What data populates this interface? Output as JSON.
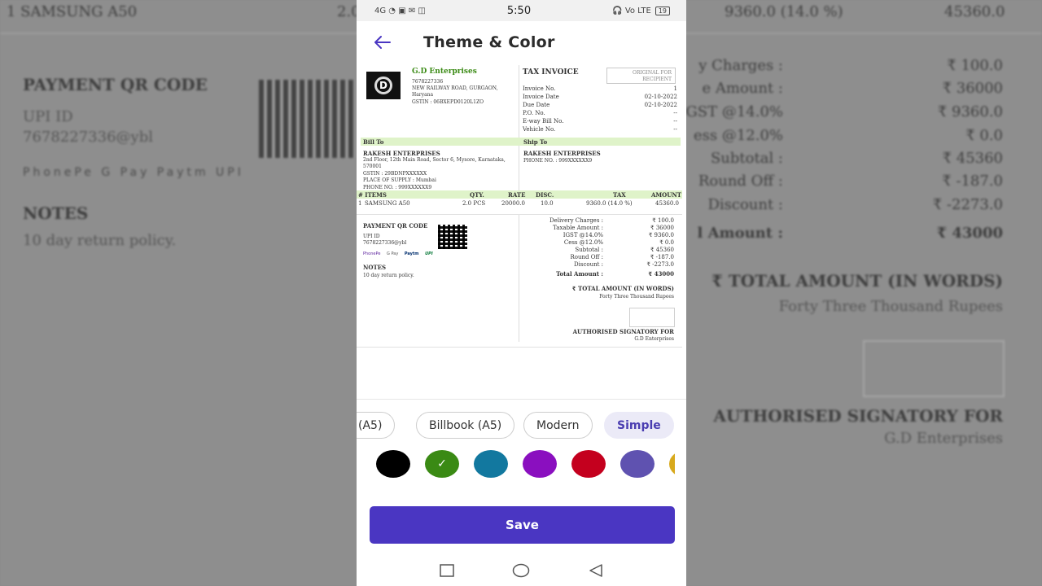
{
  "background": {
    "top_item": "1  SAMSUNG A50",
    "top_tax": "9360.0 (14.0 %)",
    "top_amount": "45360.0",
    "top_frag": "2.0",
    "payment_qr_title": "PAYMENT QR CODE",
    "upi_label": "UPI ID",
    "upi_value": "7678227336@ybl",
    "notes_title": "NOTES",
    "notes_text": "10 day return policy.",
    "summary": [
      {
        "label": "y Charges :",
        "value": "₹ 100.0"
      },
      {
        "label": "e Amount :",
        "value": "₹ 36000"
      },
      {
        "label": "GST @14.0%",
        "value": "₹ 9360.0"
      },
      {
        "label": "ess @12.0%",
        "value": "₹ 0.0"
      },
      {
        "label": "Subtotal :",
        "value": "₹ 45360"
      },
      {
        "label": "Round Off :",
        "value": "₹ -187.0"
      },
      {
        "label": "Discount :",
        "value": "₹ -2273.0"
      },
      {
        "label": "l Amount :",
        "value": "₹ 43000"
      }
    ],
    "total_words_title": "₹ TOTAL AMOUNT (IN WORDS)",
    "total_words": "Forty Three Thousand Rupees",
    "signatory": "AUTHORISED SIGNATORY FOR",
    "company": "G.D Enterprises",
    "pay_icons": "PhonePe  G Pay  Paytm  UPI"
  },
  "status_bar": {
    "time": "5:50",
    "left_icons": "4G  ◔  ▣  ✉  ◫",
    "right_icons": "🎧  Vo LTE",
    "battery": "19"
  },
  "app_bar": {
    "title": "Theme & Color"
  },
  "invoice": {
    "company_name": "G.D Enterprises",
    "phone": "7678227336",
    "address1": "NEW RAILWAY ROAD, GURGAON,",
    "address2": "Haryana",
    "gstin": "GSTIN : 06BXEPD0120L1ZO",
    "title": "TAX INVOICE",
    "original_for": "ORIGINAL FOR",
    "recipient": "RECIPIENT",
    "meta": [
      {
        "label": "Invoice No.",
        "value": "1"
      },
      {
        "label": "Invoice Date",
        "value": "02-10-2022"
      },
      {
        "label": "Due Date",
        "value": "02-10-2022"
      },
      {
        "label": "P.O. No.",
        "value": "--"
      },
      {
        "label": "E-way Bill No.",
        "value": "--"
      },
      {
        "label": "Vehicle No.",
        "value": "--"
      }
    ],
    "bill_to_label": "Bill To",
    "ship_to_label": "Ship To",
    "bill_name": "RAKESH ENTERPRISES",
    "bill_addr1": "2nd Floor, 12th Main Road, Sector 6, Mysore, Karnataka,",
    "bill_addr2": "570001",
    "bill_gstin": "GSTIN : 29BDNPXXXXXX",
    "bill_supply": "PLACE OF SUPPLY : Mumbai",
    "bill_phone": "PHONE NO. : 999XXXXXX9",
    "ship_name": "RAKESH ENTERPRISES",
    "ship_phone": "PHONE NO. : 999XXXXXX9",
    "columns": {
      "items": "# ITEMS",
      "qty": "QTY.",
      "rate": "RATE",
      "disc": "DISC.",
      "tax": "TAX",
      "amount": "AMOUNT"
    },
    "row": {
      "num": "1",
      "item": "SAMSUNG A50",
      "qty": "2.0 PCS",
      "rate": "20000.0",
      "disc": "10.0",
      "tax": "9360.0 (14.0 %)",
      "amount": "45360.0"
    },
    "payment_qr_title": "PAYMENT QR CODE",
    "upi_label": "UPI ID",
    "upi_value": "7678227336@ybl",
    "pay_icons": [
      "PhonePe",
      "G Pay",
      "Paytm",
      "UPI"
    ],
    "notes_title": "NOTES",
    "notes_text": "10 day return policy.",
    "summary": [
      {
        "label": "Delivery Charges :",
        "value": "₹ 100.0"
      },
      {
        "label": "Taxable Amount :",
        "value": "₹ 36000"
      },
      {
        "label": "IGST @14.0%",
        "value": "₹ 9360.0"
      },
      {
        "label": "Cess @12.0%",
        "value": "₹ 0.0"
      },
      {
        "label": "Subtotal :",
        "value": "₹ 45360"
      },
      {
        "label": "Round Off :",
        "value": "₹ -187.0"
      },
      {
        "label": "Discount :",
        "value": "₹ -2273.0"
      }
    ],
    "total_label": "Total Amount :",
    "total_value": "₹ 43000",
    "words_title": "₹ TOTAL AMOUNT (IN WORDS)",
    "words_value": "Forty Three Thousand Rupees",
    "signatory": "AUTHORISED SIGNATORY FOR",
    "signatory_company": "G.D Enterprises"
  },
  "themes": [
    {
      "label": "(A5)",
      "active": false
    },
    {
      "label": "Billbook (A5)",
      "active": false
    },
    {
      "label": "Modern",
      "active": false
    },
    {
      "label": "Simple",
      "active": true
    }
  ],
  "colors": [
    {
      "name": "black",
      "hex": "#000000",
      "selected": false
    },
    {
      "name": "green",
      "hex": "#3a8a14",
      "selected": true
    },
    {
      "name": "teal",
      "hex": "#12789f",
      "selected": false
    },
    {
      "name": "purple",
      "hex": "#8a0fbf",
      "selected": false
    },
    {
      "name": "red",
      "hex": "#c4001e",
      "selected": false
    },
    {
      "name": "indigo",
      "hex": "#5f52b0",
      "selected": false
    },
    {
      "name": "gold",
      "hex": "#d8a91c",
      "selected": false
    }
  ],
  "save_label": "Save",
  "check_glyph": "✓"
}
